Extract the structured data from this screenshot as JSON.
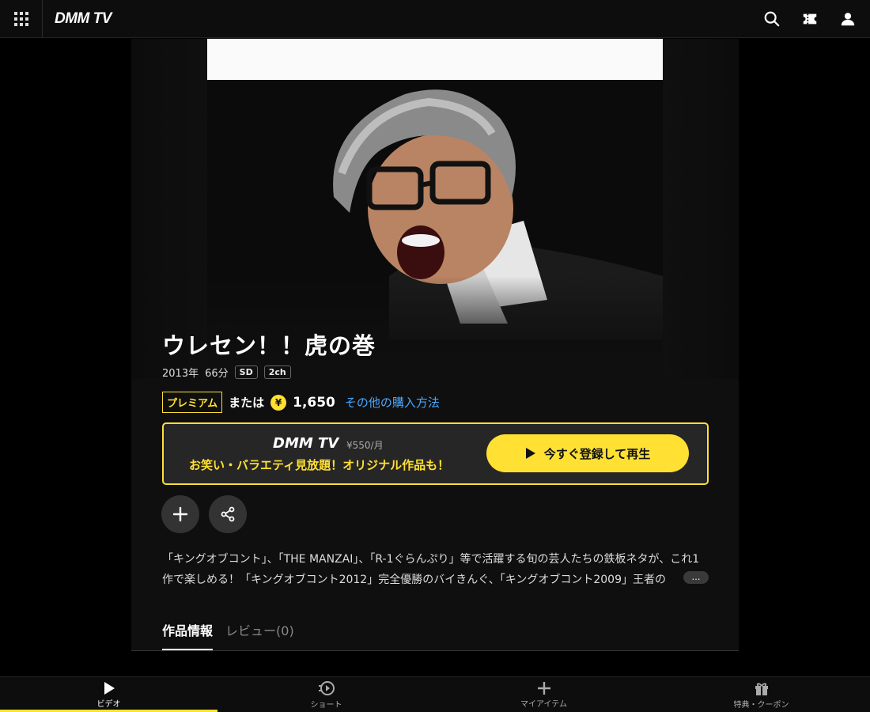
{
  "app": {
    "logo": "DMM TV"
  },
  "header": {
    "icons": [
      "menu-grid-icon",
      "search-icon",
      "ticket-icon",
      "user-icon"
    ]
  },
  "content": {
    "title": "ウレセン！！虎の巻",
    "year": "2013年",
    "duration": "66分",
    "quality": "SD",
    "audio": "2ch"
  },
  "purchase": {
    "premium_label": "プレミアム",
    "or_label": "または",
    "coin_symbol": "¥",
    "price": "1,650",
    "other_methods": "その他の購入方法"
  },
  "promo": {
    "logo": "DMM TV",
    "monthly_price": "¥550/月",
    "tagline": "お笑い・バラエティ見放題！オリジナル作品も！",
    "cta_label": "今すぐ登録して再生"
  },
  "description": "「キングオブコント」、「THE MANZAI」、「R-1ぐらんぷり」等で活躍する旬の芸人たちの鉄板ネタが、これ1作で楽しめる！「キングオブコント2012」完全優勝のバイきんぐ、「キングオブコント2009」王者の",
  "more_label": "…",
  "tabs": [
    {
      "label": "作品情報",
      "active": true
    },
    {
      "label": "レビュー(0)",
      "active": false
    }
  ],
  "bottom_nav": [
    {
      "label": "ビデオ",
      "icon": "play-icon",
      "active": true
    },
    {
      "label": "ショート",
      "icon": "short-play-icon",
      "active": false
    },
    {
      "label": "マイアイテム",
      "icon": "plus-icon",
      "active": false
    },
    {
      "label": "特典・クーポン",
      "icon": "gift-icon",
      "active": false
    }
  ],
  "colors": {
    "accent": "#ffe033",
    "link": "#4aa8ff",
    "background": "#000000"
  }
}
